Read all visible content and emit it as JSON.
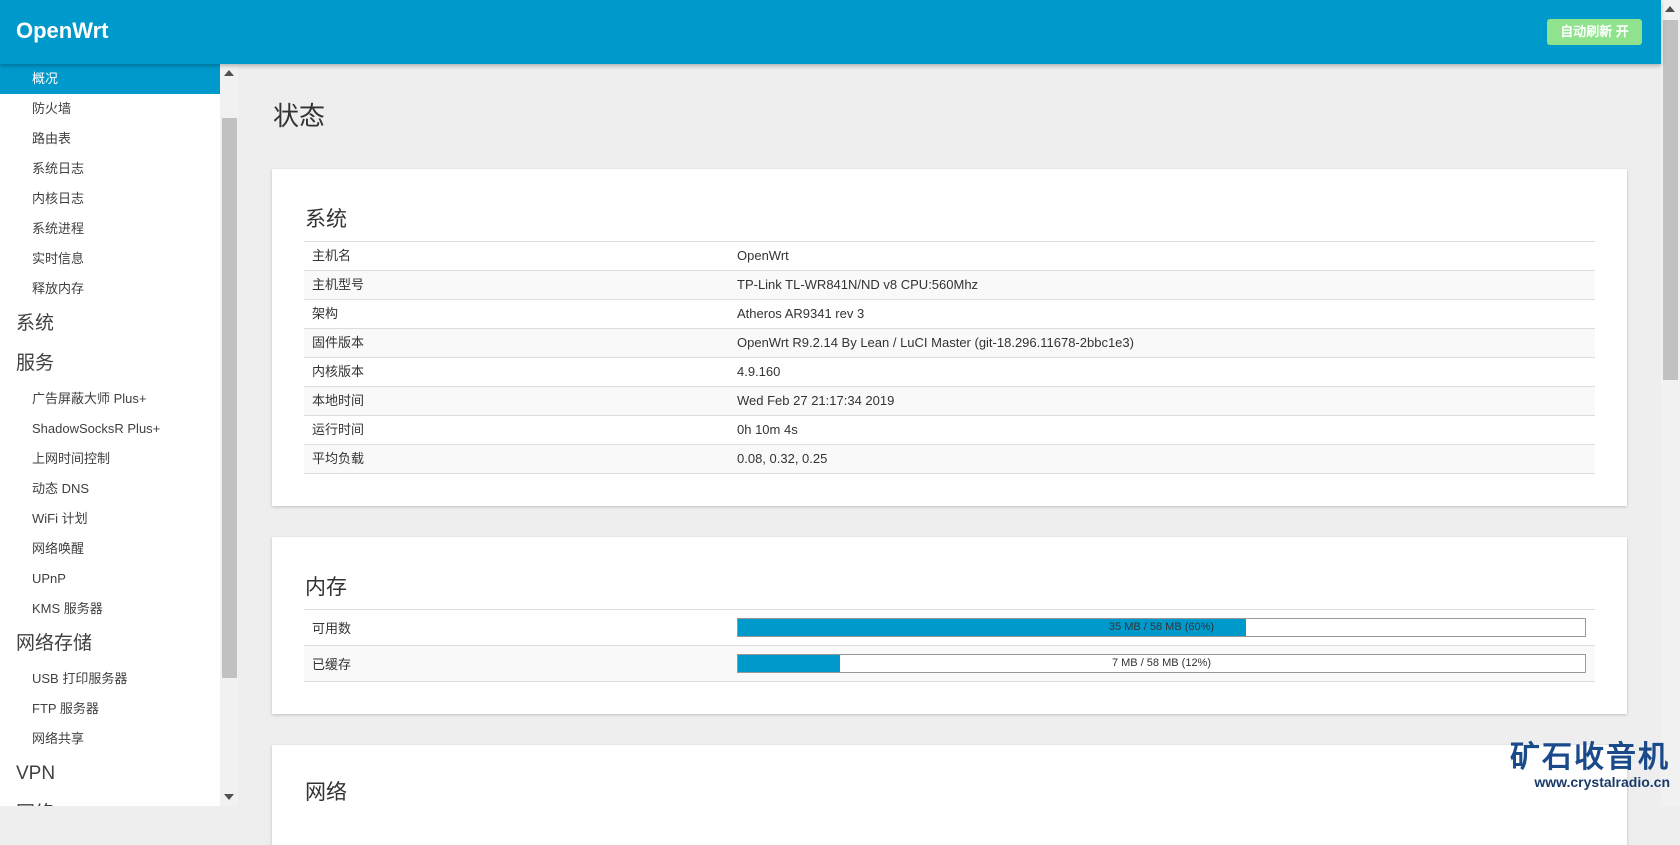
{
  "header": {
    "brand": "OpenWrt",
    "refresh_button": "自动刷新 开"
  },
  "sidebar": {
    "status_items": [
      "概况",
      "防火墙",
      "路由表",
      "系统日志",
      "内核日志",
      "系统进程",
      "实时信息",
      "释放内存"
    ],
    "heading_system": "系统",
    "heading_services": "服务",
    "services_items": [
      "广告屏蔽大师 Plus+",
      "ShadowSocksR Plus+",
      "上网时间控制",
      "动态 DNS",
      "WiFi 计划",
      "网络唤醒",
      "UPnP",
      "KMS 服务器"
    ],
    "heading_nas": "网络存储",
    "nas_items": [
      "USB 打印服务器",
      "FTP 服务器",
      "网络共享"
    ],
    "heading_vpn": "VPN",
    "heading_network": "网络"
  },
  "page": {
    "title": "状态"
  },
  "system": {
    "title": "系统",
    "rows": [
      {
        "k": "主机名",
        "v": "OpenWrt"
      },
      {
        "k": "主机型号",
        "v": "TP-Link TL-WR841N/ND v8 CPU:560Mhz"
      },
      {
        "k": "架构",
        "v": "Atheros AR9341 rev 3"
      },
      {
        "k": "固件版本",
        "v": "OpenWrt R9.2.14 By Lean / LuCI Master (git-18.296.11678-2bbc1e3)"
      },
      {
        "k": "内核版本",
        "v": "4.9.160"
      },
      {
        "k": "本地时间",
        "v": "Wed Feb 27 21:17:34 2019"
      },
      {
        "k": "运行时间",
        "v": "0h 10m 4s"
      },
      {
        "k": "平均负载",
        "v": "0.08, 0.32, 0.25"
      }
    ]
  },
  "memory": {
    "title": "内存",
    "rows": [
      {
        "k": "可用数",
        "text": "35 MB / 58 MB (60%)",
        "percent": 60
      },
      {
        "k": "已缓存",
        "text": "7 MB / 58 MB (12%)",
        "percent": 12
      }
    ]
  },
  "network": {
    "title": "网络"
  },
  "watermark": {
    "title": "矿石收音机",
    "url": "www.crystalradio.cn"
  },
  "colors": {
    "accent": "#0099cc",
    "refresh": "#8fe38c"
  }
}
